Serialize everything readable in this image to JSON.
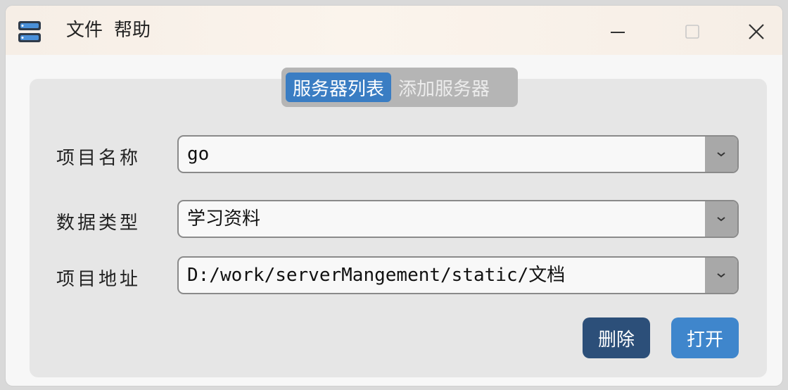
{
  "menu": {
    "file": "文件",
    "help": "帮助"
  },
  "tabs": {
    "active": "服务器列表",
    "inactive": "添加服务器"
  },
  "fields": [
    {
      "label": "项目名称",
      "value": "go"
    },
    {
      "label": "数据类型",
      "value": "学习资料"
    },
    {
      "label": "项目地址",
      "value": "D:/work/serverMangement/static/文档"
    }
  ],
  "buttons": {
    "delete": "删除",
    "open": "打开"
  },
  "colors": {
    "active_tab": "#3a7dc3",
    "delete_button": "#2c4f79",
    "open_button": "#3f86cc"
  },
  "icons": {
    "app": "server-stack-icon",
    "minimize": "minimize-icon",
    "maximize": "maximize-icon",
    "close": "close-icon",
    "dropdown": "chevron-down-icon"
  }
}
